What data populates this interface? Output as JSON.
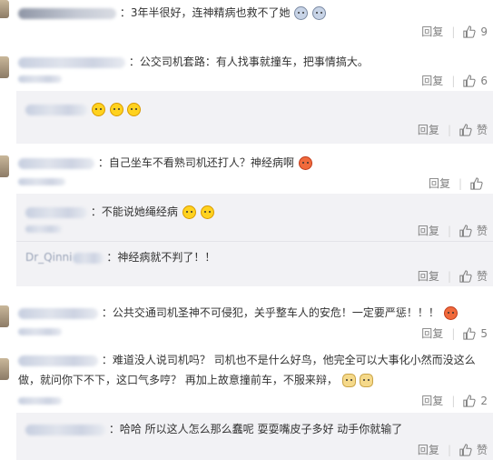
{
  "comments": [
    {
      "id": "c1",
      "text": "：3年半很好，连神精病也救不了她",
      "likes": "9",
      "reply_label": "回复"
    },
    {
      "id": "c2",
      "text": "：公交司机套路：有人找事就撞车，把事情搞大。",
      "likes": "6",
      "reply_label": "回复",
      "replies": [
        {
          "likes_label": "赞",
          "reply_label": "回复"
        }
      ]
    },
    {
      "id": "c3",
      "text": "：自己坐车不看熟司机还打人？神经病啊",
      "reply_label": "回复",
      "replies": [
        {
          "text": "：不能说她绳经病",
          "reply_label": "回复",
          "likes_label": "赞"
        },
        {
          "prefix": "Dr_Qinni",
          "text": "：神经病就不判了！！",
          "reply_label": "回复",
          "likes_label": "赞"
        }
      ]
    },
    {
      "id": "c4",
      "text": "：公共交通司机圣神不可侵犯，关乎整车人的安危！一定要严惩！！！",
      "likes": "5",
      "reply_label": "回复"
    },
    {
      "id": "c5",
      "text_line1": "：难道没人说司机吗？ 司机也不是什么好鸟，他完全可以大事化小然而没这么",
      "text_line2": "做，就问你下不下，这口气多哼？ 再加上故意撞前车，不服来辩，",
      "likes": "2",
      "reply_label": "回复",
      "replies": [
        {
          "text": "：哈哈 所以这人怎么那么蠢呢 耍耍嘴皮子多好 动手你就输了",
          "reply_label": "回复",
          "likes_label": "赞"
        }
      ]
    }
  ],
  "icons": {
    "thumb": "thumbs-up-icon",
    "cry": "crying-face-icon",
    "grin": "grinning-face-icon",
    "angry": "angry-face-icon",
    "tear": "laughing-tears-icon",
    "dog": "doge-icon"
  },
  "colors": {
    "text": "#333333",
    "muted": "#808080",
    "reply_bg": "#f2f2f5"
  }
}
